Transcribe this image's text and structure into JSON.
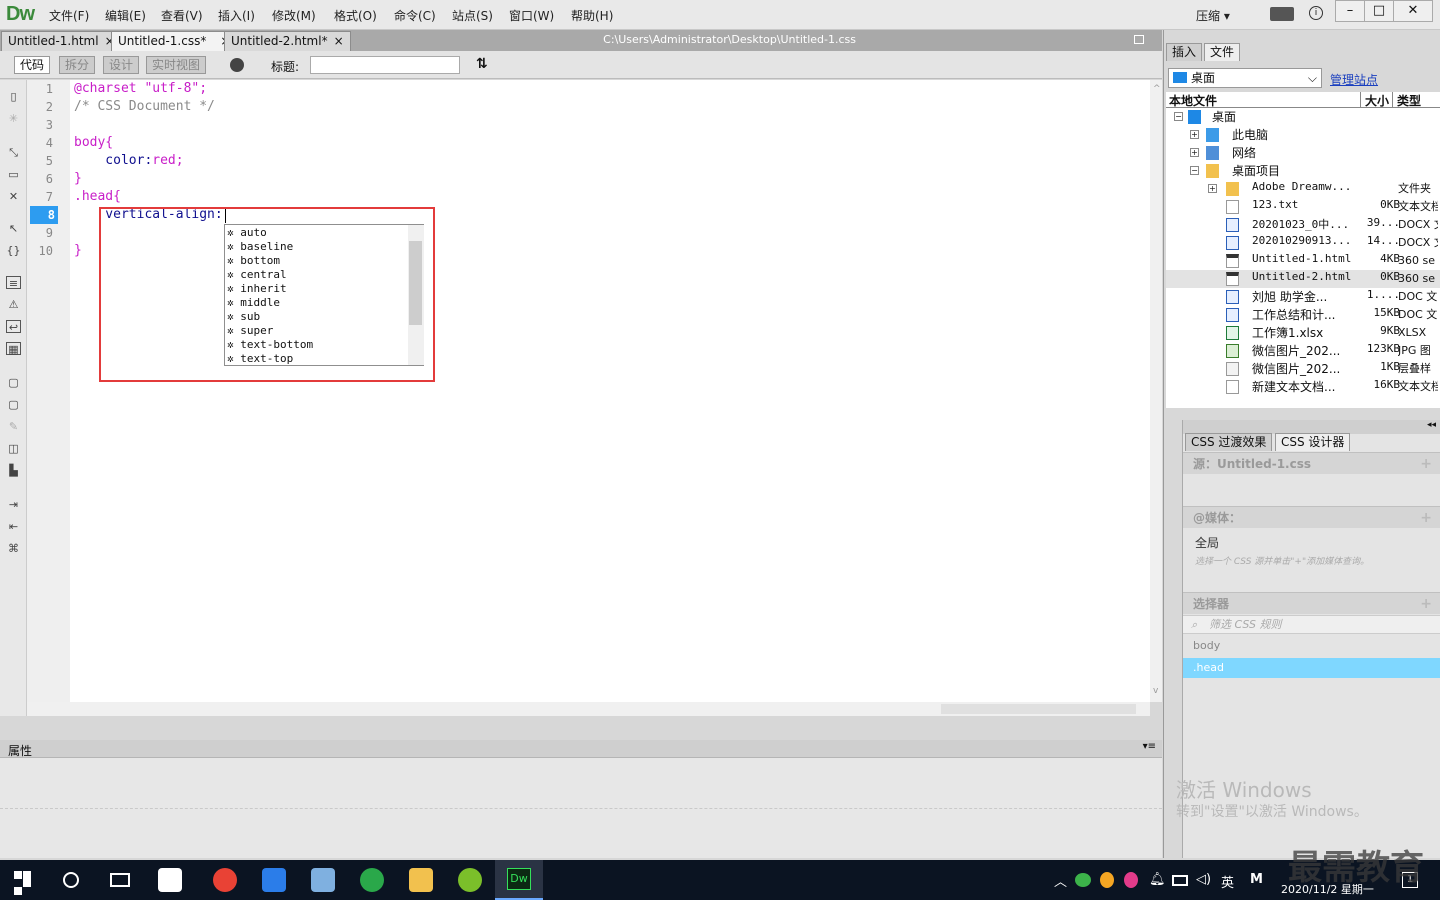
{
  "app": {
    "logo": "Dw",
    "menus": [
      "文件(F)",
      "编辑(E)",
      "查看(V)",
      "插入(I)",
      "修改(M)",
      "格式(O)",
      "命令(C)",
      "站点(S)",
      "窗口(W)",
      "帮助(H)"
    ],
    "compress": "压缩",
    "window_buttons": [
      "–",
      "□",
      "✕"
    ]
  },
  "tabs": [
    {
      "label": "Untitled-1.html",
      "close": "×"
    },
    {
      "label": "Untitled-1.css*",
      "close": "×"
    },
    {
      "label": "Untitled-2.html*",
      "close": "×"
    }
  ],
  "doc_path": "C:\\Users\\Administrator\\Desktop\\Untitled-1.css",
  "toolbar": {
    "views": [
      "代码",
      "拆分",
      "设计",
      "实时视图"
    ],
    "title_label": "标题:",
    "title_value": ""
  },
  "editor": {
    "line_numbers": [
      "1",
      "2",
      "3",
      "4",
      "5",
      "6",
      "7",
      "8",
      "9",
      "10"
    ],
    "current_line": "8",
    "l1a": "@charset ",
    "l1b": "\"utf-8\";",
    "l2": "/* CSS Document */",
    "l4": "body{",
    "l5a": "    color:",
    "l5b": "red;",
    "l6": "}",
    "l7": ".head{",
    "l8": "    vertical-align:",
    "l10": "}"
  },
  "code_hints": [
    "auto",
    "baseline",
    "bottom",
    "central",
    "inherit",
    "middle",
    "sub",
    "super",
    "text-bottom",
    "text-top"
  ],
  "properties_panel": {
    "title": "属性"
  },
  "right_panel": {
    "tabs": [
      "插入",
      "文件"
    ],
    "location": "桌面",
    "manage": "管理站点",
    "columns": {
      "name": "本地文件",
      "size": "大小",
      "type": "类型"
    },
    "tree": [
      {
        "name": "桌面",
        "size": "",
        "type": ""
      },
      {
        "name": "此电脑",
        "size": "",
        "type": ""
      },
      {
        "name": "网络",
        "size": "",
        "type": ""
      },
      {
        "name": "桌面项目",
        "size": "",
        "type": ""
      },
      {
        "name": "Adobe Dreamw...",
        "size": "",
        "type": "文件夹"
      },
      {
        "name": "123.txt",
        "size": "0KB",
        "type": "文本文档"
      },
      {
        "name": "20201023_0中...",
        "size": "39...",
        "type": "DOCX 文"
      },
      {
        "name": "20201029091З...",
        "size": "14...",
        "type": "DOCX 文"
      },
      {
        "name": "Untitled-1.html",
        "size": "4KB",
        "type": "360 se"
      },
      {
        "name": "Untitled-2.html",
        "size": "0KB",
        "type": "360 se"
      },
      {
        "name": "刘旭 助学金...",
        "size": "1....",
        "type": "DOC 文"
      },
      {
        "name": "工作总结和计...",
        "size": "15KB",
        "type": "DOC 文"
      },
      {
        "name": "工作簿1.xlsx",
        "size": "9KB",
        "type": "XLSX"
      },
      {
        "name": "微信图片_202...",
        "size": "123KB",
        "type": "JPG 图"
      },
      {
        "name": "微信图片_202...",
        "size": "1KB",
        "type": "层叠样"
      },
      {
        "name": "新建文本文档...",
        "size": "16KB",
        "type": "文本文档"
      }
    ],
    "css_tabs": [
      "CSS 过渡效果",
      "CSS 设计器"
    ],
    "source": "源：Untitled-1.css",
    "media": "@媒体：",
    "global": "全局",
    "media_hint": "选择一个 CSS 源并单击\"+\"添加媒体查询。",
    "selectors": "选择器",
    "filter": "筛选 CSS 规则",
    "selector_list": [
      "body",
      ".head"
    ]
  },
  "watermark": {
    "line1": "激活 Windows",
    "line2": "转到\"设置\"以激活 Windows。",
    "brand": "最需教育"
  },
  "taskbar": {
    "tray_items": [
      "英",
      "M"
    ],
    "datetime": "2020/11/2 星期一",
    "notif": "1"
  }
}
